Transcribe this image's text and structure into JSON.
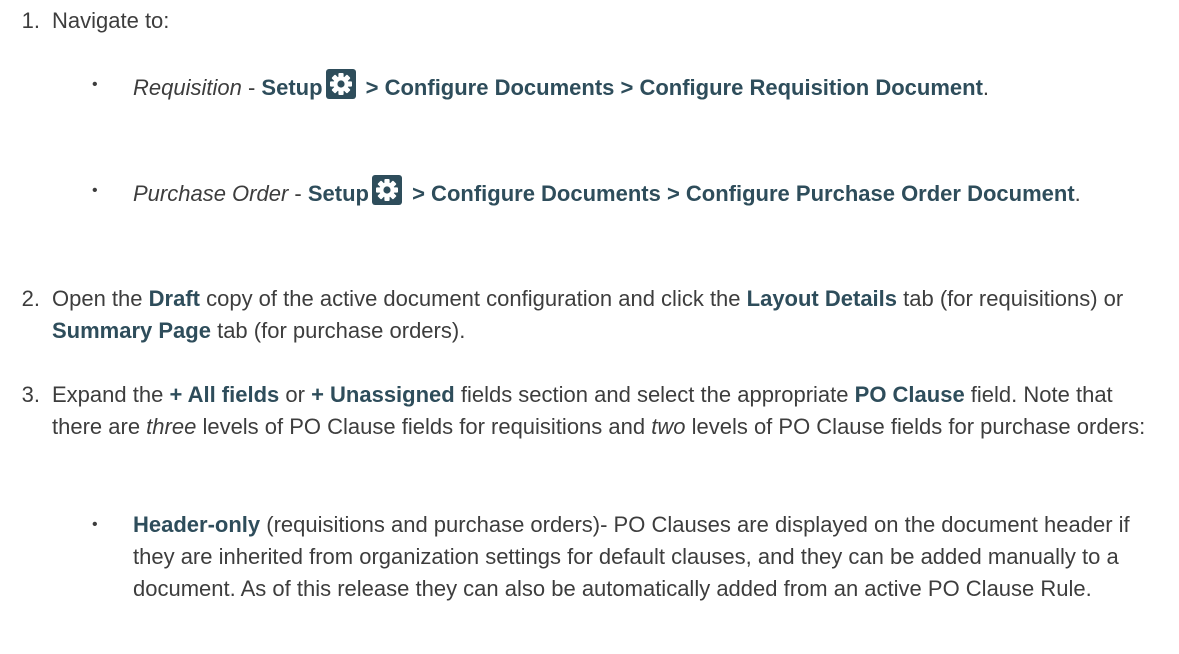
{
  "steps": [
    {
      "number": "1.",
      "text": "Navigate to:",
      "bullets": [
        {
          "item": "Requisition",
          "dash": " - ",
          "path_start": "Setup",
          "path_rest": " > Configure Documents > Configure Requisition Document",
          "end": ".",
          "icon": "gear-icon"
        },
        {
          "item": "Purchase Order",
          "dash": " - ",
          "path_start": "Setup",
          "path_rest": " > Configure Documents > Configure Purchase Order Document",
          "end": ".",
          "icon": "gear-icon"
        }
      ]
    },
    {
      "number": "2.",
      "t1": "Open the ",
      "b1": "Draft",
      "t2": " copy of the active document configuration and click the ",
      "b2": "Layout Details",
      "t3": " tab (for requisitions) or ",
      "b3": "Summary Page",
      "t4": " tab (for purchase orders)."
    },
    {
      "number": "3.",
      "t1": "Expand the ",
      "b1": "+ All fields",
      "t2": " or ",
      "b2": "+ Unassigned",
      "t3": " fields section and select the appropriate ",
      "b3": "PO Clause",
      "t4": " field. Note that there are ",
      "i1": "three",
      "t5": " levels of PO Clause fields for requisitions and ",
      "i2": "two",
      "t6": " levels of PO Clause fields for purchase orders:",
      "bullets": [
        {
          "b": "Header-only",
          "t": " (requisitions and purchase orders)- PO Clauses are displayed on the document header if they are inherited from organization settings for default clauses, and they can be added manually to a document. As of this release they can also be automatically added from an active PO Clause Rule."
        }
      ]
    }
  ],
  "bullet_symbol": "•",
  "colors": {
    "text": "#3d3d3d",
    "bold_link": "#2e4d5b",
    "icon": "#2e4d5b"
  }
}
